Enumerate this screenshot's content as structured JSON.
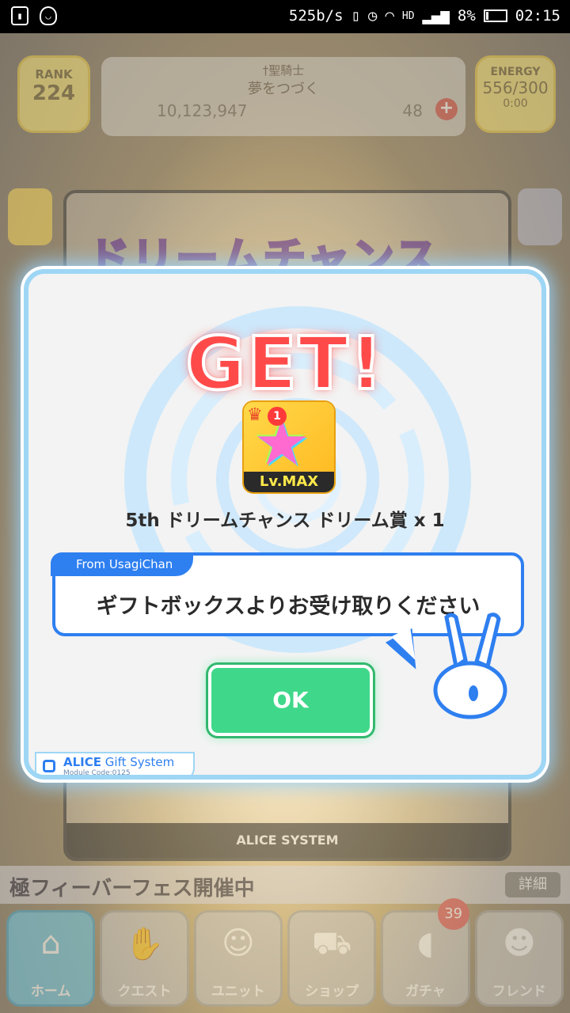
{
  "status_bar": {
    "network_speed": "525b/s",
    "battery_percent": "8%",
    "time": "02:15",
    "hd_label": "HD"
  },
  "header": {
    "rank_label": "RANK",
    "rank_value": "224",
    "title_line1": "†聖騎士",
    "title_line2": "夢をつづく",
    "coins": "10,123,947",
    "gems": "48",
    "energy_label": "ENERGY",
    "energy_value": "556/300",
    "energy_timer": "0:00"
  },
  "background_panel": {
    "logo_text": "ドリームチャンス",
    "footer_label": "ALICE SYSTEM"
  },
  "news": {
    "text": "極フィーバーフェス開催中",
    "more_label": "詳細"
  },
  "nav": {
    "items": [
      {
        "label": "ホーム",
        "icon": "home-icon"
      },
      {
        "label": "クエスト",
        "icon": "handshake-icon"
      },
      {
        "label": "ユニット",
        "icon": "bunny-icon"
      },
      {
        "label": "ショップ",
        "icon": "cart-icon"
      },
      {
        "label": "ガチャ",
        "icon": "egg-icon"
      },
      {
        "label": "フレンド",
        "icon": "friends-icon"
      }
    ],
    "gacha_badge": "39"
  },
  "modal": {
    "title": "GET!",
    "item_level": "Lv.MAX",
    "item_count_badge": "1",
    "item_name": "5th ドリームチャンス ドリーム賞 x 1",
    "from_label": "From UsagiChan",
    "message": "ギフトボックスよりお受け取りください",
    "ok_label": "OK",
    "system_name_bold": "ALICE",
    "system_name_rest": " Gift System",
    "module_code": "Module Code:0125"
  },
  "colors": {
    "accent_blue": "#2e7ff0",
    "ok_green": "#3fd88a",
    "get_red": "#ff4a4a"
  }
}
